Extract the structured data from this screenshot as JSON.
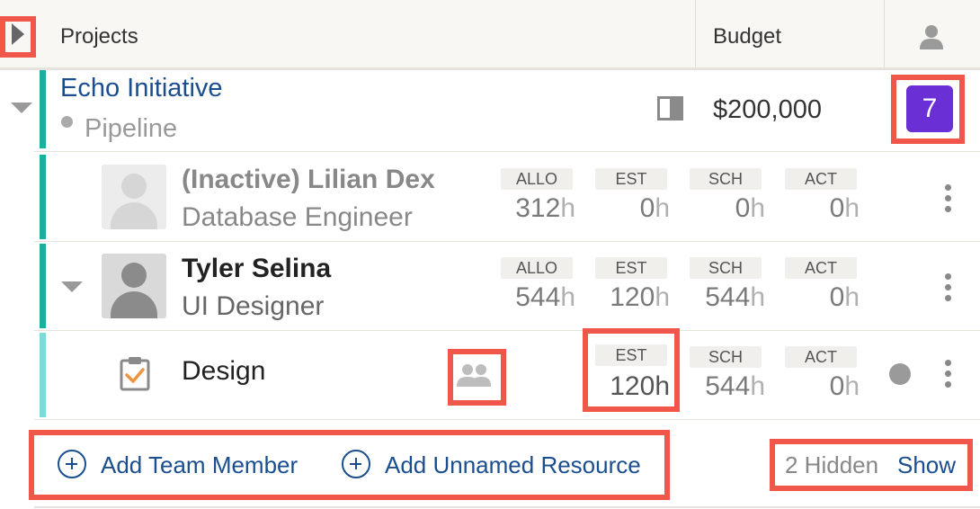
{
  "header": {
    "projects_label": "Projects",
    "budget_label": "Budget"
  },
  "project": {
    "name": "Echo Initiative",
    "status": "Pipeline",
    "budget": "$200,000",
    "member_count": "7",
    "accent_color": "#1ab0a0"
  },
  "column_labels": {
    "allo": "ALLO",
    "est": "EST",
    "sch": "SCH",
    "act": "ACT"
  },
  "hour_unit": "h",
  "members": [
    {
      "name": "(Inactive) Lilian Dex",
      "role": "Database Engineer",
      "allo": "312",
      "est": "0",
      "sch": "0",
      "act": "0"
    },
    {
      "name": "Tyler Selina",
      "role": "UI Designer",
      "allo": "544",
      "est": "120",
      "sch": "544",
      "act": "0"
    }
  ],
  "task": {
    "name": "Design",
    "est": "120",
    "sch": "544",
    "act": "0"
  },
  "footer": {
    "add_team_member": "Add Team Member",
    "add_unnamed_resource": "Add Unnamed Resource",
    "hidden_text": "2 Hidden",
    "show_label": "Show"
  },
  "colors": {
    "highlight": "#f0564a",
    "link": "#1a4e8f",
    "badge": "#6b2fd6"
  }
}
